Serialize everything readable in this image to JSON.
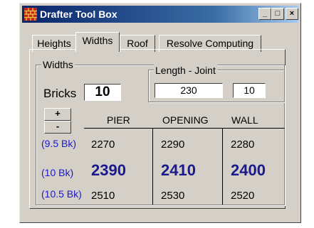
{
  "window": {
    "title": "Drafter Tool Box",
    "buttons": {
      "minimize": "_",
      "maximize": "□",
      "close": "×"
    }
  },
  "tabs": [
    "Heights",
    "Widths",
    "Roof",
    "Resolve Computing"
  ],
  "active_tab": "Widths",
  "widths_group": {
    "label": "Widths",
    "bricks_label": "Bricks",
    "bricks_value": "10",
    "increment_label": "+",
    "decrement_label": "-"
  },
  "length_joint_group": {
    "label": "Length - Joint",
    "length_value": "230",
    "joint_value": "10"
  },
  "table": {
    "headers": [
      "PIER",
      "OPENING",
      "WALL"
    ],
    "rows": [
      {
        "label": "(9.5 Bk)",
        "values": [
          "2270",
          "2290",
          "2280"
        ],
        "emphasis": false
      },
      {
        "label": "(10 Bk)",
        "values": [
          "2390",
          "2410",
          "2400"
        ],
        "emphasis": true
      },
      {
        "label": "(10.5 Bk)",
        "values": [
          "2510",
          "2530",
          "2520"
        ],
        "emphasis": false
      }
    ]
  },
  "colors": {
    "title_bar_start": "#0a246a",
    "title_bar_end": "#a6caf0",
    "row_label": "#1a1ac8",
    "emphasis_value": "#1a1a8c",
    "window_face": "#d4d0c8"
  }
}
